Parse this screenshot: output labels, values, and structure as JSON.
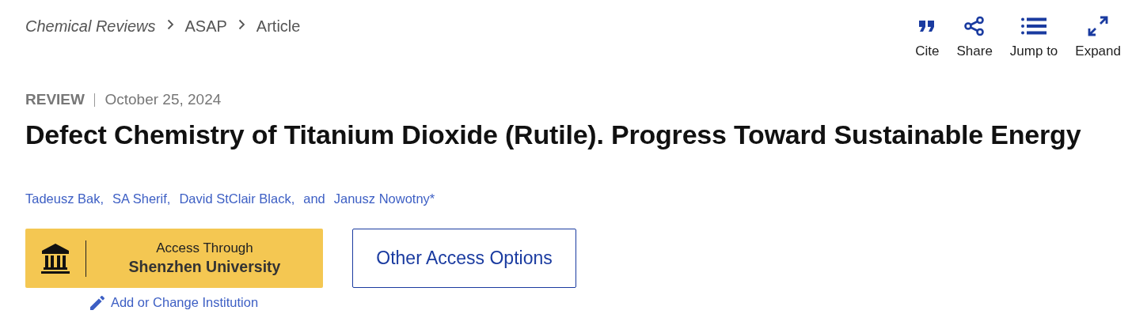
{
  "breadcrumb": [
    {
      "label": "Chemical Reviews",
      "kind": "journal"
    },
    {
      "label": "ASAP",
      "kind": "plain"
    },
    {
      "label": "Article",
      "kind": "plain"
    }
  ],
  "actions": [
    {
      "label": "Cite",
      "kind": "cite"
    },
    {
      "label": "Share",
      "kind": "share"
    },
    {
      "label": "Jump to",
      "kind": "list"
    },
    {
      "label": "Expand",
      "kind": "expand"
    }
  ],
  "article_type": "REVIEW",
  "date": "October 25, 2024",
  "title": "Defect Chemistry of Titanium Dioxide (Rutile). Progress Toward Sustainable Energy",
  "authors": [
    "Tadeusz Bak,",
    "SA Sherif,",
    "David StClair Black,",
    "Janusz Nowotny*"
  ],
  "author_conjunction": "and",
  "access": {
    "line_1": "Access Through",
    "line_2": "Shenzhen University",
    "other_button": "Other Access Options",
    "change_link": "Add or Change Institution"
  }
}
